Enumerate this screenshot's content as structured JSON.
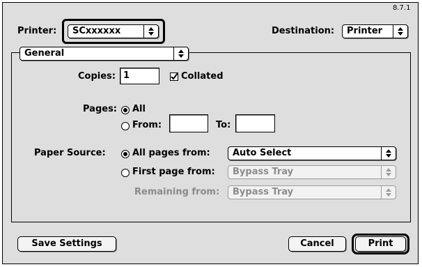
{
  "header": {
    "version": "8.7.1",
    "printer_label": "Printer:",
    "printer_value": "SCxxxxxx",
    "destination_label": "Destination:",
    "destination_value": "Printer"
  },
  "panel": {
    "selected": "General"
  },
  "copies": {
    "label": "Copies:",
    "value": "1",
    "collated_label": "Collated",
    "collated": true
  },
  "pages": {
    "label": "Pages:",
    "all_label": "All",
    "from_label": "From:",
    "from_value": "",
    "to_label": "To:",
    "to_value": "",
    "selected": "All"
  },
  "paper_source": {
    "label": "Paper Source:",
    "all_pages_label": "All pages from:",
    "all_pages_value": "Auto Select",
    "first_page_label": "First page from:",
    "first_page_value": "Bypass Tray",
    "remaining_label": "Remaining from:",
    "remaining_value": "Bypass Tray",
    "selected": "All pages from"
  },
  "footer": {
    "save_label": "Save Settings",
    "cancel_label": "Cancel",
    "print_label": "Print"
  }
}
